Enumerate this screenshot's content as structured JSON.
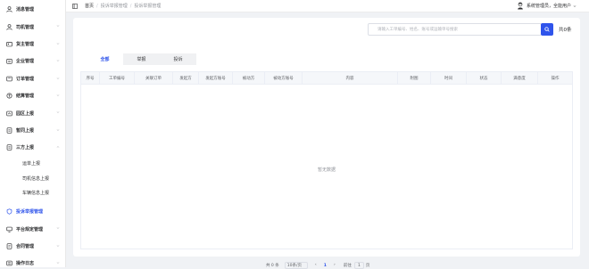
{
  "sidebar": {
    "items": [
      {
        "label": "消息管理",
        "icon": "user-icon",
        "expand": false
      },
      {
        "label": "司机管理",
        "icon": "user-icon",
        "expand": true
      },
      {
        "label": "货主管理",
        "icon": "id-card-icon",
        "expand": true
      },
      {
        "label": "企业管理",
        "icon": "building-icon",
        "expand": true
      },
      {
        "label": "订单管理",
        "icon": "cart-icon",
        "expand": true
      },
      {
        "label": "结算管理",
        "icon": "settlement-icon",
        "expand": true
      },
      {
        "label": "园区上报",
        "icon": "park-icon",
        "expand": true
      },
      {
        "label": "暂同上报",
        "icon": "report-icon",
        "expand": true
      },
      {
        "label": "三方上报",
        "icon": "report-icon",
        "expand": true
      }
    ],
    "sub_items": [
      "运单上报",
      "司机信息上报",
      "车辆信息上报"
    ],
    "active": {
      "label": "投诉举报管理",
      "icon": "shield-icon"
    },
    "after": [
      {
        "label": "平台规定管理",
        "icon": "monitor-icon",
        "expand": true
      },
      {
        "label": "合同管理",
        "icon": "contract-icon",
        "expand": true
      },
      {
        "label": "操作日志",
        "icon": "log-icon",
        "expand": true
      }
    ]
  },
  "header": {
    "breadcrumb": [
      "首页",
      "投诉举报管理",
      "投诉举报管理"
    ],
    "user": "系统管理员，全能用户"
  },
  "toolbar": {
    "search_placeholder": "请输入工单编号、姓名、账号或运输单号搜索",
    "count": "共0条"
  },
  "tabs": [
    "全部",
    "举报",
    "投诉"
  ],
  "table": {
    "columns": [
      "序号",
      "工单编号",
      "关联订单",
      "发起方",
      "发起方账号",
      "被动方",
      "被动方账号",
      "内容",
      "附图",
      "时间",
      "状态",
      "满意度",
      "操作"
    ],
    "empty_text": "暂无数据"
  },
  "pagination": {
    "total": "共 0 条",
    "page_size": "10条/页",
    "page": "1",
    "goto_label": "前往",
    "goto_value": "1",
    "page_unit": "页"
  },
  "colors": {
    "accent": "#2f54eb"
  }
}
